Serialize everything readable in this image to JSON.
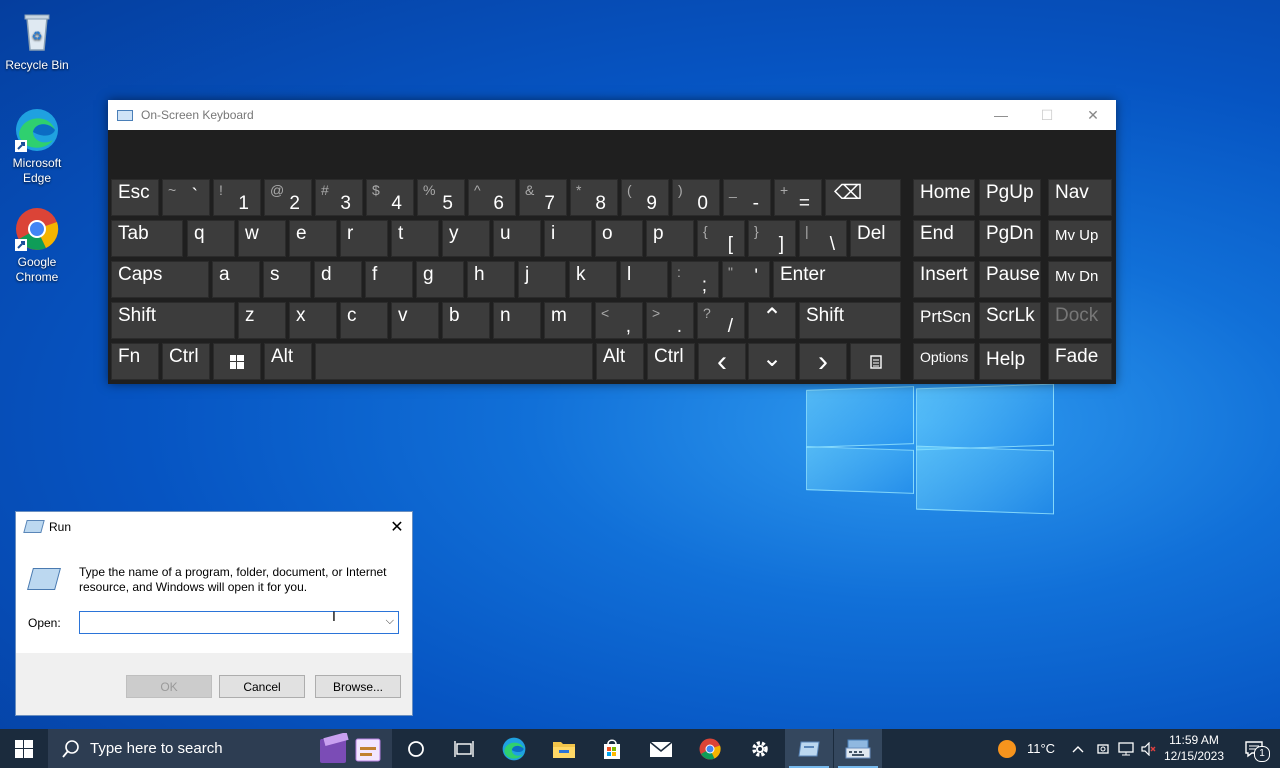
{
  "desktop": {
    "icons": [
      {
        "label": "Recycle Bin"
      },
      {
        "label": "Microsoft Edge"
      },
      {
        "label": "Google Chrome"
      }
    ]
  },
  "osk": {
    "title": "On-Screen Keyboard",
    "keys": {
      "esc": "Esc",
      "backtick": {
        "top": "~",
        "main": "`"
      },
      "k1": {
        "top": "!",
        "main": "1"
      },
      "k2": {
        "top": "@",
        "main": "2"
      },
      "k3": {
        "top": "#",
        "main": "3"
      },
      "k4": {
        "top": "$",
        "main": "4"
      },
      "k5": {
        "top": "%",
        "main": "5"
      },
      "k6": {
        "top": "^",
        "main": "6"
      },
      "k7": {
        "top": "&",
        "main": "7"
      },
      "k8": {
        "top": "*",
        "main": "8"
      },
      "k9": {
        "top": "(",
        "main": "9"
      },
      "k0": {
        "top": ")",
        "main": "0"
      },
      "minus": {
        "top": "_",
        "main": "-"
      },
      "equals": {
        "top": "+",
        "main": "="
      },
      "backspace": "⌫",
      "home": "Home",
      "pgup": "PgUp",
      "nav": "Nav",
      "tab": "Tab",
      "q": "q",
      "w": "w",
      "e": "e",
      "r": "r",
      "t": "t",
      "y": "y",
      "u": "u",
      "i": "i",
      "o": "o",
      "p": "p",
      "lbracket": {
        "top": "{",
        "main": "["
      },
      "rbracket": {
        "top": "}",
        "main": "]"
      },
      "backslash": {
        "top": "|",
        "main": "\\"
      },
      "del": "Del",
      "end": "End",
      "pgdn": "PgDn",
      "mvup": "Mv Up",
      "caps": "Caps",
      "a": "a",
      "s": "s",
      "d": "d",
      "f": "f",
      "g": "g",
      "h": "h",
      "j": "j",
      "k": "k",
      "l": "l",
      "semicolon": {
        "top": ":",
        "main": ";"
      },
      "quote": {
        "top": "\"",
        "main": "'"
      },
      "enter": "Enter",
      "insert": "Insert",
      "pause": "Pause",
      "mvdn": "Mv Dn",
      "shift_l": "Shift",
      "z": "z",
      "x": "x",
      "c": "c",
      "v": "v",
      "b": "b",
      "n": "n",
      "m": "m",
      "comma": {
        "top": "<",
        "main": ","
      },
      "period": {
        "top": ">",
        "main": "."
      },
      "slash": {
        "top": "?",
        "main": "/"
      },
      "up": "⌃",
      "shift_r": "Shift",
      "prtscn": "PrtScn",
      "scrlk": "ScrLk",
      "dock": "Dock",
      "fn": "Fn",
      "ctrl_l": "Ctrl",
      "alt_l": "Alt",
      "alt_r": "Alt",
      "ctrl_r": "Ctrl",
      "left": "‹",
      "down": "⌄",
      "right": "›",
      "options": "Options",
      "help": "Help",
      "fade": "Fade"
    }
  },
  "run": {
    "title": "Run",
    "description": "Type the name of a program, folder, document, or Internet resource, and Windows will open it for you.",
    "open_label": "Open:",
    "open_value": "",
    "ok": "OK",
    "cancel": "Cancel",
    "browse": "Browse..."
  },
  "taskbar": {
    "search_placeholder": "Type here to search",
    "weather": "11°C",
    "time": "11:59 AM",
    "date": "12/15/2023",
    "notification_count": "1"
  }
}
